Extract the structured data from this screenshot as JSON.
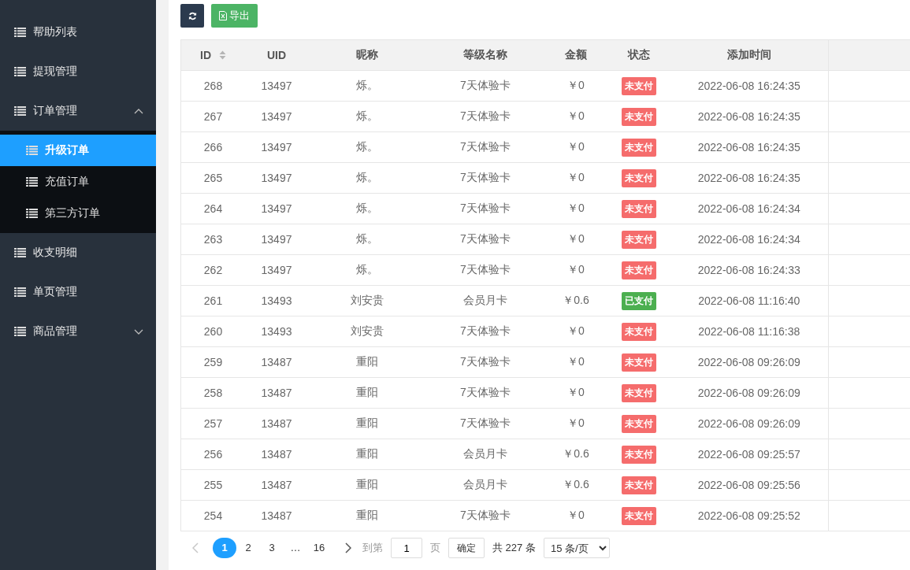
{
  "sidebar": {
    "items": [
      {
        "label": "帮助列表"
      },
      {
        "label": "提现管理"
      },
      {
        "label": "订单管理",
        "expanded": true,
        "children": [
          {
            "label": "升级订单",
            "selected": true
          },
          {
            "label": "充值订单",
            "selected": false
          },
          {
            "label": "第三方订单",
            "selected": false
          }
        ]
      },
      {
        "label": "收支明细"
      },
      {
        "label": "单页管理"
      },
      {
        "label": "商品管理",
        "expanded": false
      }
    ]
  },
  "toolbar": {
    "export_label": "导出"
  },
  "table": {
    "columns": [
      "ID",
      "UID",
      "昵称",
      "等级名称",
      "金额",
      "状态",
      "添加时间"
    ],
    "rows": [
      {
        "id": "268",
        "uid": "13497",
        "nickname": "烁。",
        "level": "7天体验卡",
        "amount": "￥0",
        "status": "未支付",
        "paid": false,
        "time": "2022-06-08 16:24:35"
      },
      {
        "id": "267",
        "uid": "13497",
        "nickname": "烁。",
        "level": "7天体验卡",
        "amount": "￥0",
        "status": "未支付",
        "paid": false,
        "time": "2022-06-08 16:24:35"
      },
      {
        "id": "266",
        "uid": "13497",
        "nickname": "烁。",
        "level": "7天体验卡",
        "amount": "￥0",
        "status": "未支付",
        "paid": false,
        "time": "2022-06-08 16:24:35"
      },
      {
        "id": "265",
        "uid": "13497",
        "nickname": "烁。",
        "level": "7天体验卡",
        "amount": "￥0",
        "status": "未支付",
        "paid": false,
        "time": "2022-06-08 16:24:35"
      },
      {
        "id": "264",
        "uid": "13497",
        "nickname": "烁。",
        "level": "7天体验卡",
        "amount": "￥0",
        "status": "未支付",
        "paid": false,
        "time": "2022-06-08 16:24:34"
      },
      {
        "id": "263",
        "uid": "13497",
        "nickname": "烁。",
        "level": "7天体验卡",
        "amount": "￥0",
        "status": "未支付",
        "paid": false,
        "time": "2022-06-08 16:24:34"
      },
      {
        "id": "262",
        "uid": "13497",
        "nickname": "烁。",
        "level": "7天体验卡",
        "amount": "￥0",
        "status": "未支付",
        "paid": false,
        "time": "2022-06-08 16:24:33"
      },
      {
        "id": "261",
        "uid": "13493",
        "nickname": "刘安贵",
        "level": "会员月卡",
        "amount": "￥0.6",
        "status": "已支付",
        "paid": true,
        "time": "2022-06-08 11:16:40"
      },
      {
        "id": "260",
        "uid": "13493",
        "nickname": "刘安贵",
        "level": "7天体验卡",
        "amount": "￥0",
        "status": "未支付",
        "paid": false,
        "time": "2022-06-08 11:16:38"
      },
      {
        "id": "259",
        "uid": "13487",
        "nickname": "重阳",
        "level": "7天体验卡",
        "amount": "￥0",
        "status": "未支付",
        "paid": false,
        "time": "2022-06-08 09:26:09"
      },
      {
        "id": "258",
        "uid": "13487",
        "nickname": "重阳",
        "level": "7天体验卡",
        "amount": "￥0",
        "status": "未支付",
        "paid": false,
        "time": "2022-06-08 09:26:09"
      },
      {
        "id": "257",
        "uid": "13487",
        "nickname": "重阳",
        "level": "7天体验卡",
        "amount": "￥0",
        "status": "未支付",
        "paid": false,
        "time": "2022-06-08 09:26:09"
      },
      {
        "id": "256",
        "uid": "13487",
        "nickname": "重阳",
        "level": "会员月卡",
        "amount": "￥0.6",
        "status": "未支付",
        "paid": false,
        "time": "2022-06-08 09:25:57"
      },
      {
        "id": "255",
        "uid": "13487",
        "nickname": "重阳",
        "level": "会员月卡",
        "amount": "￥0.6",
        "status": "未支付",
        "paid": false,
        "time": "2022-06-08 09:25:56"
      },
      {
        "id": "254",
        "uid": "13487",
        "nickname": "重阳",
        "level": "7天体验卡",
        "amount": "￥0",
        "status": "未支付",
        "paid": false,
        "time": "2022-06-08 09:25:52"
      }
    ]
  },
  "pagination": {
    "pages": [
      {
        "label": "1",
        "selected": true
      },
      {
        "label": "2",
        "selected": false
      },
      {
        "label": "3",
        "selected": false
      },
      {
        "label": "…",
        "selected": false
      },
      {
        "label": "16",
        "selected": false
      }
    ],
    "goto_label": "到第",
    "goto_value": "1",
    "page_unit": "页",
    "confirm": "确定",
    "total": "共 227 条",
    "page_size": "15 条/页"
  }
}
